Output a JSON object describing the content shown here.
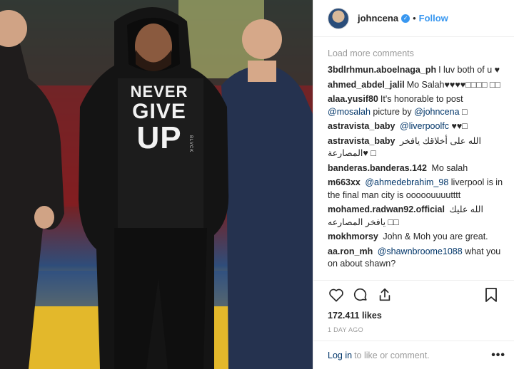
{
  "photo": {
    "shirt_line1": "NEVER",
    "shirt_line2": "GIVE",
    "shirt_line3": "UP",
    "shirt_brand": "BLVCK"
  },
  "header": {
    "username": "johncena",
    "verified_icon": "verified-badge-icon",
    "separator": "•",
    "follow_label": "Follow"
  },
  "comments": {
    "load_more": "Load more comments",
    "items": [
      {
        "user": "3bdlrhmun.aboelnaga_ph",
        "text": "I luv both of u ♥"
      },
      {
        "user": "ahmed_abdel_jalil",
        "text": "Mo Salah♥♥♥♥□□□□ □□"
      },
      {
        "user": "alaa.yusif80",
        "text": "It's honorable to post",
        "mention1": "@mosalah",
        "text2": "picture by",
        "mention2": "@johncena",
        "text3": "□"
      },
      {
        "user": "astravista_baby",
        "mention1": "@liverpoolfc",
        "text": "♥♥□"
      },
      {
        "user": "astravista_baby",
        "text": "الله على أخلاقك يافخر المصارعة♥ □"
      },
      {
        "user": "banderas.banderas.142",
        "text": "Mo salah"
      },
      {
        "user": "m663xx",
        "mention1": "@ahmedebrahim_98",
        "text": "liverpool is in the final man city is ooooouuuutttt"
      },
      {
        "user": "mohamed.radwan92.official",
        "text": "الله عليك يافخر المصارعه □□"
      },
      {
        "user": "mokhmorsy",
        "text": "John & Moh you are great."
      },
      {
        "user": "aa.ron_mh",
        "mention1": "@shawnbroome1088",
        "text": "what you on about shawn?"
      }
    ]
  },
  "actions": {
    "like_icon": "heart-icon",
    "comment_icon": "comment-icon",
    "share_icon": "share-icon",
    "save_icon": "bookmark-icon",
    "likes": "172.411 likes",
    "time": "1 DAY AGO"
  },
  "footer": {
    "login_label": "Log in",
    "login_suffix": "to like or comment.",
    "more_label": "•••"
  }
}
